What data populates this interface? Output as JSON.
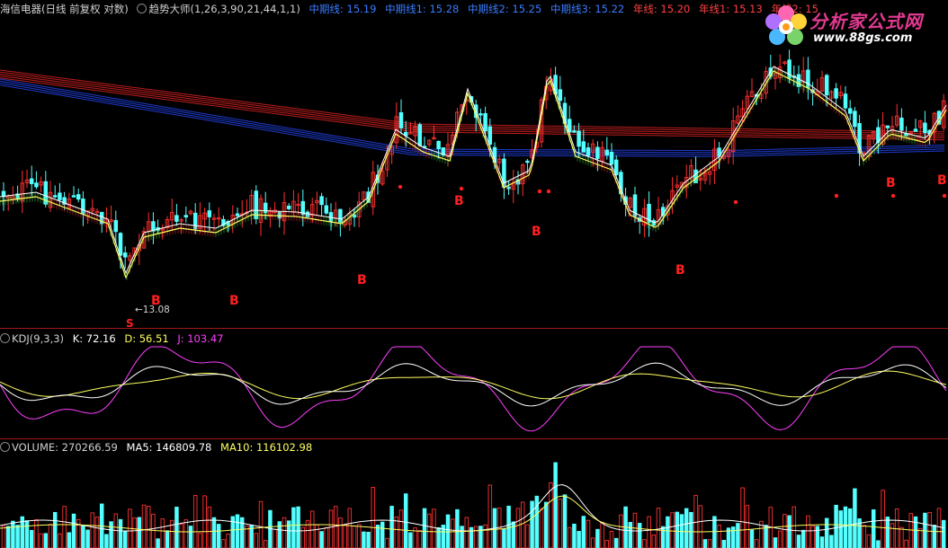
{
  "colors": {
    "up": "#ff3030",
    "down": "#54ffff",
    "kline": "#ffffff",
    "dline": "#ffff60",
    "jline": "#ff40ff",
    "ma5v": "#ffffff",
    "ma10v": "#ffff60",
    "signal": "#ff2020",
    "sep": "#a01818"
  },
  "header": {
    "stock_title": "海信电器(日线 前复权 对数)",
    "indicator": "趋势大师(1,26,3,90,21,44,1,1)",
    "mid1": "中期线: 15.19",
    "mid2": "中期线1: 15.28",
    "mid3": "中期线2: 15.25",
    "mid4": "中期线3: 15.22",
    "year1": "年线: 15.20",
    "year2": "年线1: 15.13",
    "year3": "年线2: 15"
  },
  "logo": {
    "title": "分析家公式网",
    "url": "www.88gs.com"
  },
  "main_chart": {
    "low_label": "←13.08",
    "sell_label": "S",
    "buy_label": "B",
    "buy_count": 10
  },
  "kdj": {
    "name": "KDJ(9,3,3)",
    "k": "K: 72.16",
    "d": "D: 56.51",
    "j": "J: 103.47"
  },
  "volume": {
    "name": "VOLUME: 270266.59",
    "ma5": "MA5: 146809.78",
    "ma10": "MA10: 116102.98"
  },
  "chart_data": {
    "type": "candlestick",
    "title": "海信电器(日线 前复权 对数)",
    "series": [
      {
        "name": "中期线",
        "last": 15.19
      },
      {
        "name": "中期线1",
        "last": 15.28
      },
      {
        "name": "中期线2",
        "last": 15.25
      },
      {
        "name": "中期线3",
        "last": 15.22
      },
      {
        "name": "年线",
        "last": 15.2
      },
      {
        "name": "年线1",
        "last": 15.13
      },
      {
        "name": "年线2",
        "last": 15
      }
    ],
    "price_low": 13.08,
    "kdj_last": {
      "K": 72.16,
      "D": 56.51,
      "J": 103.47
    },
    "volume_last": {
      "VOLUME": 270266.59,
      "MA5": 146809.78,
      "MA10": 116102.98
    }
  }
}
